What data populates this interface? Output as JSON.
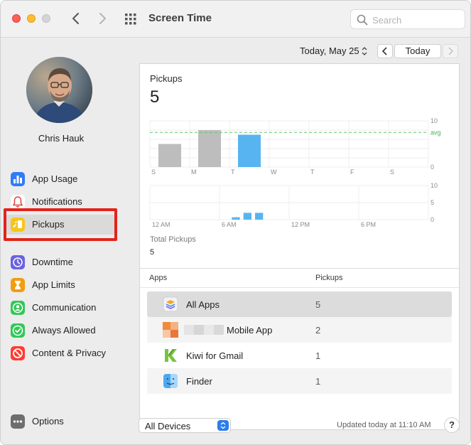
{
  "window": {
    "title": "Screen Time",
    "search_placeholder": "Search"
  },
  "user": {
    "name": "Chris Hauk"
  },
  "sidebar": {
    "items": [
      {
        "label": "App Usage",
        "icon": "bar-chart-icon",
        "color": "#2f7cf6"
      },
      {
        "label": "Notifications",
        "icon": "bell-icon",
        "color": "#ffffff"
      },
      {
        "label": "Pickups",
        "icon": "pickup-phone-icon",
        "color": "#f7c51a",
        "selected": true
      },
      {
        "label": "Downtime",
        "icon": "downtime-clock-icon",
        "color": "#6b62e0"
      },
      {
        "label": "App Limits",
        "icon": "hourglass-icon",
        "color": "#f39c12"
      },
      {
        "label": "Communication",
        "icon": "person-circle-icon",
        "color": "#34c759"
      },
      {
        "label": "Always Allowed",
        "icon": "checkmark-icon",
        "color": "#34c759"
      },
      {
        "label": "Content & Privacy",
        "icon": "restricted-icon",
        "color": "#ff3b30"
      }
    ],
    "options_label": "Options"
  },
  "header": {
    "date": "Today, May 25",
    "today_label": "Today"
  },
  "chart": {
    "title": "Pickups",
    "total": "5",
    "total_label": "Total Pickups",
    "total_value": "5",
    "avg_label": "avg"
  },
  "chart_data": [
    {
      "type": "bar",
      "categories": [
        "S",
        "M",
        "T",
        "W",
        "T",
        "F",
        "S"
      ],
      "values": [
        5,
        8,
        7,
        0,
        0,
        0,
        0
      ],
      "highlight_index": 2,
      "average": 7.5,
      "ylim": [
        0,
        10
      ],
      "yticks": [
        0,
        10
      ],
      "colors": {
        "past": "#bdbdbd",
        "today": "#58b4f0",
        "avg": "#5cc76a"
      }
    },
    {
      "type": "bar",
      "categories": [
        "12 AM",
        "6 AM",
        "12 PM",
        "6 PM"
      ],
      "hours": [
        7,
        8,
        9
      ],
      "values": [
        0.7,
        2,
        2
      ],
      "ylim": [
        0,
        10
      ],
      "yticks": [
        0,
        5,
        10
      ],
      "color": "#58b4f0"
    }
  ],
  "table": {
    "headers": {
      "apps": "Apps",
      "pickups": "Pickups"
    },
    "rows": [
      {
        "name": "All Apps",
        "count": "5",
        "icon": "stack-layers-icon"
      },
      {
        "name": "Mobile App",
        "count": "2",
        "icon": "blurred-app-icon"
      },
      {
        "name": "Kiwi for Gmail",
        "count": "1",
        "icon": "kiwi-icon"
      },
      {
        "name": "Finder",
        "count": "1",
        "icon": "finder-icon"
      }
    ]
  },
  "footer": {
    "devices_label": "All Devices",
    "updated_text": "Updated today at 11:10 AM",
    "help_label": "?"
  }
}
